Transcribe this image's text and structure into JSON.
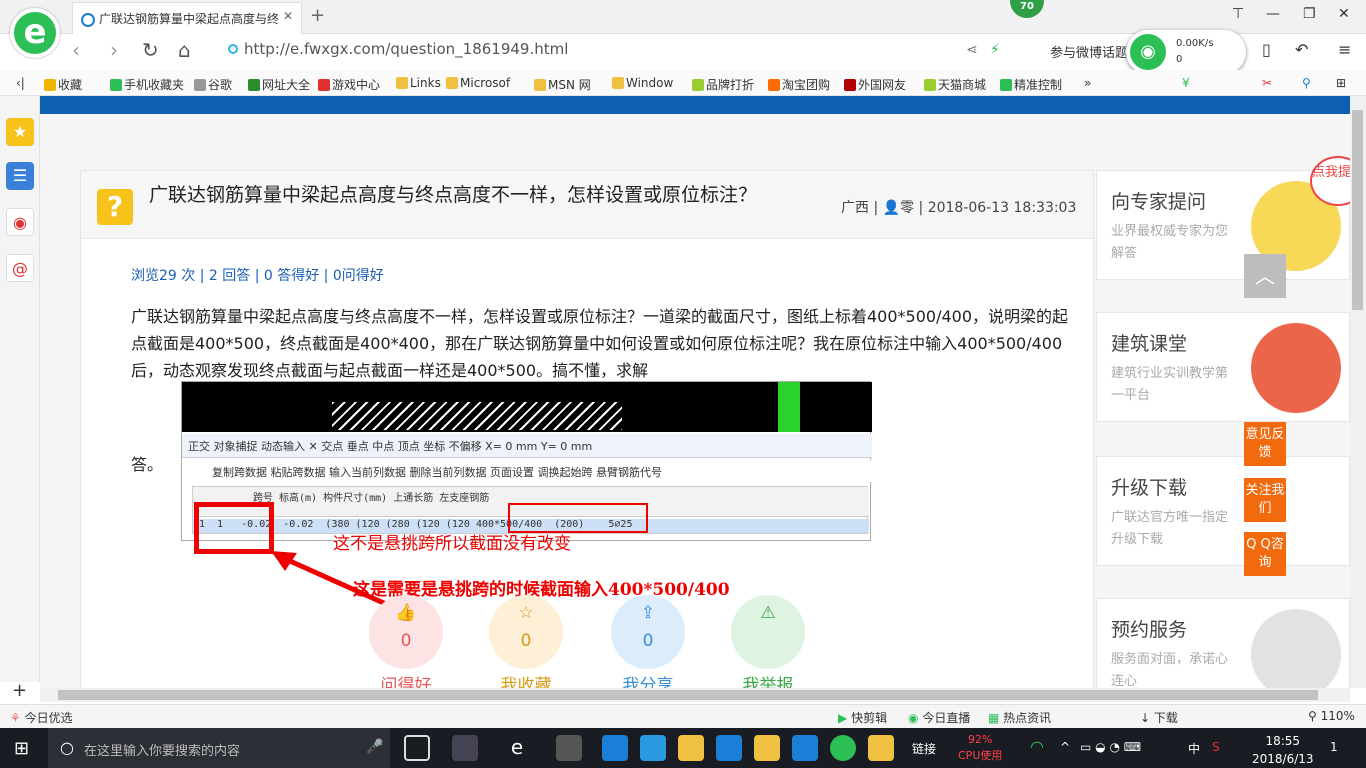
{
  "browser": {
    "tab_title": "广联达钢筋算量中梁起点高度与终",
    "new_tab": "+",
    "badge": "70",
    "url": "http://e.fwxgx.com/question_1861949.html",
    "weibo_label": "参与微博话题",
    "wifi_speed": "0.00K/s",
    "wifi_count": "0"
  },
  "bookmarks": [
    {
      "label": "收藏",
      "color": "#f0b400"
    },
    {
      "label": "手机收藏夹",
      "color": "#2bbf55"
    },
    {
      "label": "谷歌",
      "color": "#999999"
    },
    {
      "label": "网址大全",
      "color": "#2a8c2a"
    },
    {
      "label": "游戏中心",
      "color": "#e03030"
    },
    {
      "label": "Links",
      "color": "#f0c040"
    },
    {
      "label": "Microsof",
      "color": "#f0c040"
    },
    {
      "label": "MSN 网",
      "color": "#f0c040"
    },
    {
      "label": "Window",
      "color": "#f0c040"
    },
    {
      "label": "品牌打折",
      "color": "#9acd32"
    },
    {
      "label": "淘宝团购",
      "color": "#ff6a00"
    },
    {
      "label": "外国网友",
      "color": "#b00000"
    },
    {
      "label": "天猫商城",
      "color": "#9acd32"
    },
    {
      "label": "精准控制",
      "color": "#2bbf55"
    }
  ],
  "question": {
    "title": "广联达钢筋算量中梁起点高度与终点高度不一样，怎样设置或原位标注？",
    "region": "广西",
    "user": "零",
    "datetime": "2018-06-13 18:33:03",
    "stats": "浏览29 次 | 2 回答 | 0 答得好 | 0问得好",
    "body": "广联达钢筋算量中梁起点高度与终点高度不一样，怎样设置或原位标注？一道梁的截面尺寸，图纸上标着400*500/400，说明梁的起点截面是400*500，终点截面是400*400，那在广联达钢筋算量中如何设置或如何原位标注呢？我在原位标注中输入400*500/400后，动态观察发现终点截面与起点截面一样还是400*500。搞不懂，求解",
    "body_tail": "答。"
  },
  "screenshot": {
    "toolbar1": "正交 对象捕捉 动态输入 ✕ 交点 垂点 中点 顶点 坐标 不偏移 X= 0 mm Y= 0 mm",
    "toolbar2": "复制跨数据  粘贴跨数据  输入当前列数据  删除当前列数据  页面设置  调换起始跨  悬臂钢筋代号",
    "header": "跨号    标高(m)          构件尺寸(mm)                    上通长筋   左支座钢筋",
    "row": "1  1   -0.02  -0.02  (380 (120 (280 (120 (120 400*500/400  (200)    5⌀25"
  },
  "annotations": {
    "note1": "这不是悬挑跨所以截面没有改变",
    "note2": "这是需要是悬挑跨的时候截面输入400*500/400"
  },
  "actions": [
    {
      "label": "问得好",
      "count": "0",
      "color": "#e85a5a",
      "bg": "#fde3e3"
    },
    {
      "label": "我收藏",
      "count": "0",
      "color": "#d99a1a",
      "bg": "#fdf0d6"
    },
    {
      "label": "我分享",
      "count": "0",
      "color": "#3a8fd8",
      "bg": "#dcecfb"
    },
    {
      "label": "我举报",
      "count": "",
      "color": "#3aa84a",
      "bg": "#def3e2"
    }
  ],
  "right": [
    {
      "title": "向专家提问",
      "sub": "业界最权威专家为您解答"
    },
    {
      "title": "建筑课堂",
      "sub": "建筑行业实训教学第一平台"
    },
    {
      "title": "升级下载",
      "sub": "广联达官方唯一指定升级下载"
    },
    {
      "title": "预约服务",
      "sub": "服务面对面，承诺心连心"
    }
  ],
  "float": {
    "feedback": "意见反馈",
    "follow": "关注我们",
    "qq": "Q Q咨询",
    "ask": "点我提问"
  },
  "statusbar": {
    "left": "今日优选",
    "items": [
      "快剪辑",
      "今日直播",
      "热点资讯",
      "下载"
    ],
    "zoom": "110%"
  },
  "taskbar": {
    "search": "在这里输入你要搜索的内容",
    "link": "链接",
    "cpu_pct": "92%",
    "cpu_label": "CPU使用",
    "lang": "中",
    "time": "18:55",
    "date": "2018/6/13",
    "notif": "1"
  }
}
